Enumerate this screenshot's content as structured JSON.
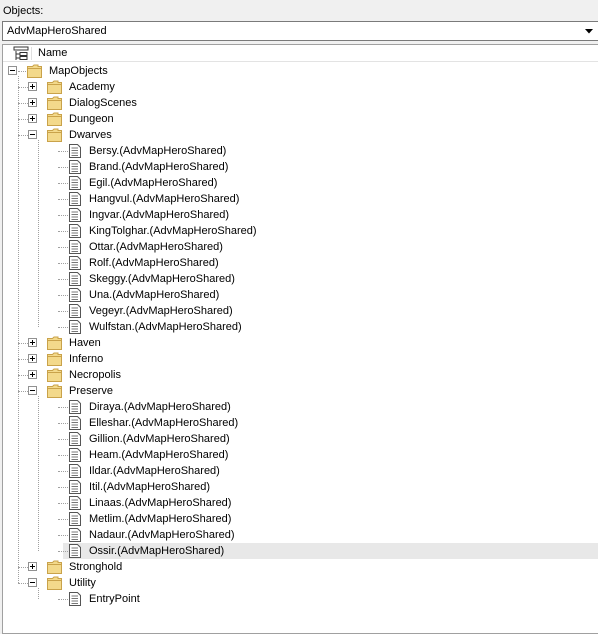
{
  "objects_label": "Objects:",
  "combo": {
    "value": "AdvMapHeroShared",
    "icon": "chevron-down-icon"
  },
  "header": {
    "name_label": "Name",
    "icon": "tree-columns-icon"
  },
  "tree": {
    "root": {
      "label": "MapObjects",
      "expanded": true
    },
    "folders": [
      {
        "label": "Academy",
        "expanded": false
      },
      {
        "label": "DialogScenes",
        "expanded": false
      },
      {
        "label": "Dungeon",
        "expanded": false
      },
      {
        "label": "Dwarves",
        "expanded": true,
        "items": [
          "Bersy.(AdvMapHeroShared)",
          "Brand.(AdvMapHeroShared)",
          "Egil.(AdvMapHeroShared)",
          "Hangvul.(AdvMapHeroShared)",
          "Ingvar.(AdvMapHeroShared)",
          "KingTolghar.(AdvMapHeroShared)",
          "Ottar.(AdvMapHeroShared)",
          "Rolf.(AdvMapHeroShared)",
          "Skeggy.(AdvMapHeroShared)",
          "Una.(AdvMapHeroShared)",
          "Vegeyr.(AdvMapHeroShared)",
          "Wulfstan.(AdvMapHeroShared)"
        ]
      },
      {
        "label": "Haven",
        "expanded": false
      },
      {
        "label": "Inferno",
        "expanded": false
      },
      {
        "label": "Necropolis",
        "expanded": false
      },
      {
        "label": "Preserve",
        "expanded": true,
        "items": [
          "Diraya.(AdvMapHeroShared)",
          "Elleshar.(AdvMapHeroShared)",
          "Gillion.(AdvMapHeroShared)",
          "Heam.(AdvMapHeroShared)",
          "Ildar.(AdvMapHeroShared)",
          "Itil.(AdvMapHeroShared)",
          "Linaas.(AdvMapHeroShared)",
          "Metlim.(AdvMapHeroShared)",
          "Nadaur.(AdvMapHeroShared)",
          "Ossir.(AdvMapHeroShared)"
        ]
      },
      {
        "label": "Stronghold",
        "expanded": false
      },
      {
        "label": "Utility",
        "expanded": true,
        "items": [
          "EntryPoint"
        ]
      }
    ],
    "selected_item": "Ossir.(AdvMapHeroShared)",
    "icons": {
      "folder": "folder-icon",
      "item": "document-icon"
    },
    "colors": {
      "folder_body": "#f3d98b",
      "folder_edge": "#c9a24a",
      "selection": "#e8e8e8"
    }
  }
}
